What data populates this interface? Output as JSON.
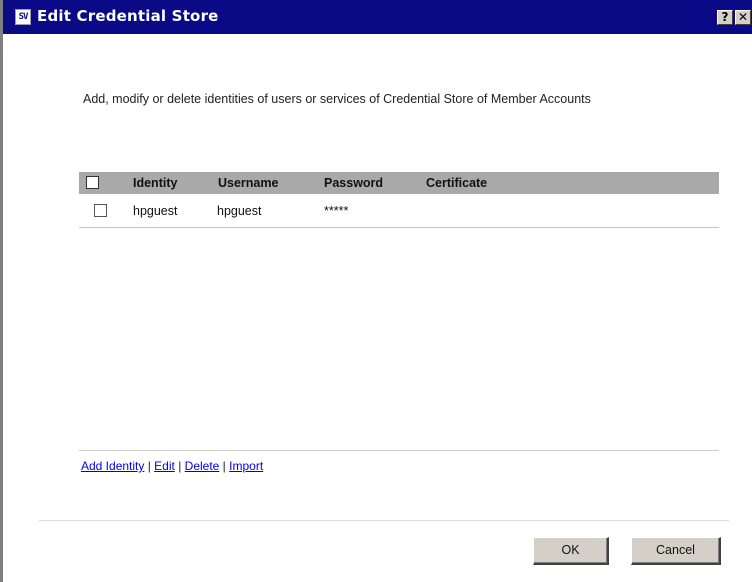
{
  "window": {
    "title": "Edit Credential Store",
    "app_icon_text": "SV",
    "help_glyph": "?",
    "close_glyph": "✕"
  },
  "intro_text": "Add, modify or delete identities of users or services of Credential Store of Member Accounts",
  "table": {
    "columns": [
      "Identity",
      "Username",
      "Password",
      "Certificate"
    ],
    "rows": [
      {
        "identity": "hpguest",
        "username": "hpguest",
        "password": "*****",
        "certificate": "",
        "checked": false
      }
    ]
  },
  "actions": {
    "add_identity": "Add Identity",
    "edit": "Edit",
    "delete": "Delete",
    "import": "Import",
    "separator": " | "
  },
  "buttons": {
    "ok": "OK",
    "cancel": "Cancel"
  },
  "colors": {
    "titlebar": "#0a0a86",
    "header": "#a9a9a9",
    "link": "#0000ee"
  }
}
